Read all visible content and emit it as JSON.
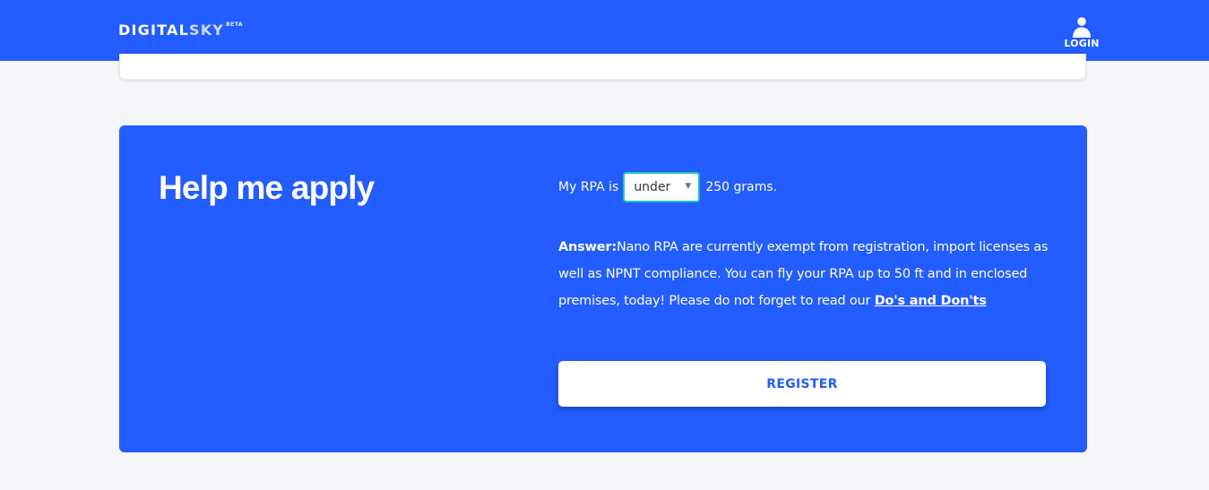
{
  "header": {
    "logo_part1": "DIGITAL",
    "logo_part2": "SKY",
    "logo_badge": "BETA",
    "login_label": "LOGIN",
    "login_icon": "user-icon",
    "brand_color": "#235cff"
  },
  "help": {
    "title": "Help me apply",
    "rpa_prefix": "My RPA is",
    "rpa_select_value": "under",
    "rpa_suffix": "250 grams.",
    "answer_label": "Answer:",
    "answer_text": "Nano RPA are currently exempt from registration, import licenses as well as NPNT compliance. You can fly your RPA up to 50 ft and in enclosed premises, today! Please do not forget to read our ",
    "answer_link": "Do's and Don'ts",
    "register_label": "REGISTER",
    "accent_color": "#1ec8b4"
  }
}
